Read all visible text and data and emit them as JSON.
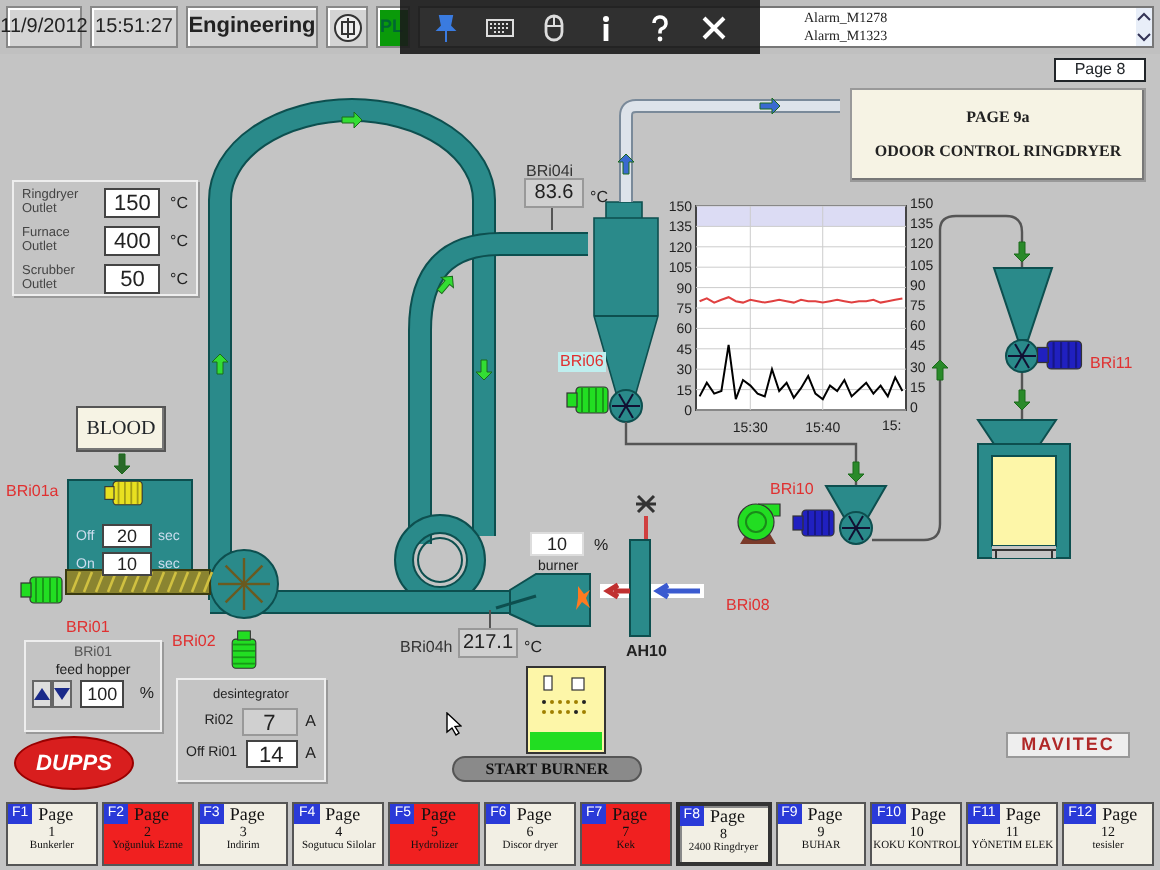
{
  "header": {
    "date": "11/9/2012",
    "time": "15:51:27",
    "user": "Engineering",
    "plc": "PL",
    "alarms": [
      "Alarm_M1278",
      "Alarm_M1323"
    ]
  },
  "page_number": "Page 8",
  "title": {
    "page": "PAGE 9a",
    "name": "ODOOR CONTROL RINGDRYER"
  },
  "setpoints": [
    {
      "label": "Ringdryer Outlet",
      "value": "150",
      "unit": "°C"
    },
    {
      "label": "Furnace Outlet",
      "value": "400",
      "unit": "°C"
    },
    {
      "label": "Scrubber Outlet",
      "value": "50",
      "unit": "°C"
    }
  ],
  "blood_button": "BLOOD",
  "timer": [
    {
      "label": "Off",
      "value": "20",
      "unit": "sec"
    },
    {
      "label": "On",
      "value": "10",
      "unit": "sec"
    }
  ],
  "motors": [
    {
      "label": "BRi01a",
      "kind": "motor",
      "color": "#e8e020",
      "highlighted": false
    },
    {
      "label": "BRi01",
      "kind": "motor",
      "color": "#22dd22",
      "highlighted": false
    },
    {
      "label": "BRi02",
      "kind": "motor",
      "color": "#22dd22",
      "highlighted": false
    },
    {
      "label": "BRi06",
      "kind": "motor",
      "color": "#22dd22",
      "highlighted": true
    },
    {
      "label": "BRi10",
      "kind": "motor",
      "color": "#2020c0",
      "highlighted": false
    },
    {
      "label": "BRi08",
      "kind": "blower",
      "color": "#22dd22",
      "highlighted": false
    },
    {
      "label": "BRi11",
      "kind": "motor",
      "color": "#2020c0",
      "highlighted": false
    }
  ],
  "feed_hopper": {
    "title": "BRi01",
    "subtitle": "feed hopper",
    "value": "100",
    "unit": "%"
  },
  "desintegrator": {
    "title": "desintegrator",
    "rows": [
      {
        "label": "Ri02",
        "value": "7",
        "unit": "A",
        "editable": false
      },
      {
        "label": "Off Ri01",
        "value": "14",
        "unit": "A",
        "editable": true
      }
    ]
  },
  "readings": [
    {
      "label": "BRi04i",
      "value": "83.6",
      "unit": "°C"
    },
    {
      "label": "BRi04h",
      "value": "217.1",
      "unit": "°C"
    }
  ],
  "burner": {
    "value": "10",
    "unit": "%",
    "label": "burner"
  },
  "heater_label": "AH10",
  "start_burner_button": "START BURNER",
  "logos": {
    "left": "DUPPS",
    "right": "MAVITEC"
  },
  "trend": {
    "chart_data": {
      "type": "line",
      "ylim": [
        0,
        150
      ],
      "grid": true,
      "bands": [
        {
          "axis": "y",
          "from": 135,
          "to": 150,
          "color": "#dcdcf4"
        }
      ],
      "yticks": [
        0,
        15,
        30,
        45,
        60,
        75,
        90,
        105,
        120,
        135,
        150
      ],
      "categories": [
        null,
        null,
        null,
        null,
        null,
        null,
        null,
        "15:30",
        null,
        null,
        null,
        null,
        null,
        null,
        null,
        null,
        null,
        "15:40",
        null,
        null,
        null,
        null,
        null,
        null,
        null,
        null,
        null,
        null,
        null
      ],
      "series": [
        {
          "color": "#e04040",
          "values": [
            80,
            82,
            79,
            81,
            83,
            80,
            79,
            81,
            80,
            79,
            80,
            81,
            80,
            79,
            81,
            80,
            80,
            79,
            80,
            81,
            80,
            79,
            80,
            80,
            81,
            79,
            80,
            81,
            82
          ]
        },
        {
          "color": "#000000",
          "values": [
            10,
            20,
            12,
            14,
            48,
            8,
            22,
            18,
            12,
            10,
            30,
            14,
            20,
            9,
            16,
            25,
            12,
            8,
            18,
            14,
            22,
            10,
            15,
            20,
            12,
            18,
            10,
            24,
            14
          ]
        }
      ]
    },
    "cut_time_label": "15:",
    "right_axis_labels": [
      "150",
      "135",
      "120",
      "105",
      "90",
      "75",
      "60",
      "45",
      "30",
      "15",
      "0"
    ]
  },
  "function_keys": [
    {
      "key": "F1",
      "label": "Page",
      "number": "1",
      "caption": "Bunkerler",
      "alarm": false,
      "selected": false
    },
    {
      "key": "F2",
      "label": "Page",
      "number": "2",
      "caption": "Yoğunluk Ezme",
      "alarm": true,
      "selected": false
    },
    {
      "key": "F3",
      "label": "Page",
      "number": "3",
      "caption": "Indirim",
      "alarm": false,
      "selected": false
    },
    {
      "key": "F4",
      "label": "Page",
      "number": "4",
      "caption": "Sogutucu Silolar",
      "alarm": false,
      "selected": false
    },
    {
      "key": "F5",
      "label": "Page",
      "number": "5",
      "caption": "Hydrolizer",
      "alarm": true,
      "selected": false
    },
    {
      "key": "F6",
      "label": "Page",
      "number": "6",
      "caption": "Discor dryer",
      "alarm": false,
      "selected": false
    },
    {
      "key": "F7",
      "label": "Page",
      "number": "7",
      "caption": "Kek",
      "alarm": true,
      "selected": false
    },
    {
      "key": "F8",
      "label": "Page",
      "number": "8",
      "caption": "2400 Ringdryer",
      "alarm": false,
      "selected": true
    },
    {
      "key": "F9",
      "label": "Page",
      "number": "9",
      "caption": "BUHAR",
      "alarm": false,
      "selected": false
    },
    {
      "key": "F10",
      "label": "Page",
      "number": "10",
      "caption": "KOKU KONTROL",
      "alarm": false,
      "selected": false
    },
    {
      "key": "F11",
      "label": "Page",
      "number": "11",
      "caption": "YÖNETIM ELEK",
      "alarm": false,
      "selected": false
    },
    {
      "key": "F12",
      "label": "Page",
      "number": "12",
      "caption": "tesisler",
      "alarm": false,
      "selected": false
    }
  ]
}
